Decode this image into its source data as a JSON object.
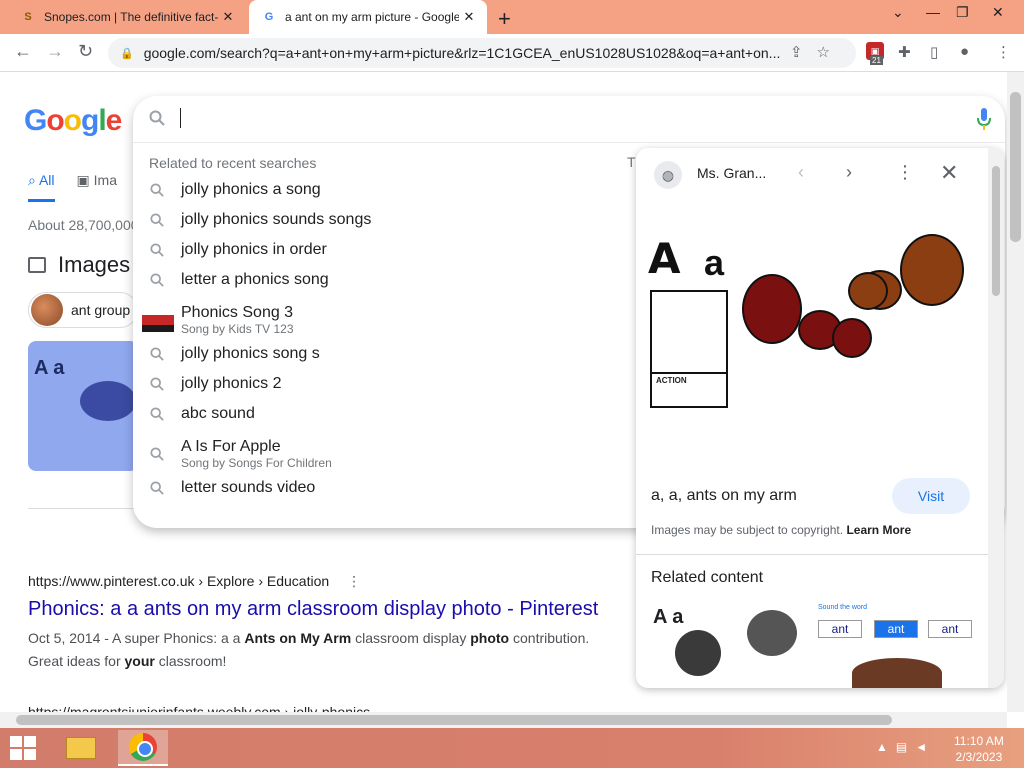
{
  "tabs": [
    {
      "title": "Snopes.com | The definitive fact-",
      "favicon": "snopes-icon",
      "active": false
    },
    {
      "title": "a ant on my arm picture - Google",
      "favicon": "google-icon",
      "active": true
    }
  ],
  "address_bar": {
    "url": "google.com/search?q=a+ant+on+my+arm+picture&rlz=1C1GCEA_enUS1028US1028&oq=a+ant+on...",
    "extension_badge": "21"
  },
  "google": {
    "logo": {
      "G": "G",
      "o1": "o",
      "o2": "o",
      "g": "g",
      "l": "l",
      "e": "e"
    },
    "tabs": {
      "all": "All",
      "images": "Ima"
    },
    "result_stats": "About 28,700,000",
    "images_heading": "Images",
    "chip_label": "ant group",
    "image_card": {
      "A": "A",
      "a": "a"
    }
  },
  "search": {
    "input_value": "",
    "related_label": "Related to recent searches",
    "edge_char": "T",
    "suggestions": [
      {
        "text": "jolly phonics a song",
        "sub": ""
      },
      {
        "text": "jolly phonics sounds songs",
        "sub": ""
      },
      {
        "text": "jolly phonics in order",
        "sub": ""
      },
      {
        "text": "letter a phonics song",
        "sub": ""
      },
      {
        "text": "Phonics Song 3",
        "sub": "Song by Kids TV 123"
      },
      {
        "text": "jolly phonics song s",
        "sub": ""
      },
      {
        "text": "jolly phonics 2",
        "sub": ""
      },
      {
        "text": "abc sound",
        "sub": ""
      },
      {
        "text": "A Is For Apple",
        "sub": "Song by Songs For Children"
      },
      {
        "text": "letter sounds video",
        "sub": ""
      }
    ]
  },
  "result": {
    "cite": "https://www.pinterest.co.uk › Explore › Education",
    "title": "Phonics: a a ants on my arm classroom display photo - Pinterest",
    "snippet": {
      "p1": "Oct 5, 2014 - A super Phonics: a a ",
      "b1": "Ants on My Arm",
      "p2": " classroom display ",
      "b2": "photo",
      "p3": " contribution. Great ideas for ",
      "b3": "your",
      "p4": " classroom!"
    },
    "next_cite": "https://magrontsjuniorinfants.weebly.com › jolly-phonics"
  },
  "preview": {
    "source": "Ms. Gran...",
    "image_text": {
      "big_A": "A",
      "small_a": "a",
      "action": "ACTION"
    },
    "title": "a, a, ants on my arm",
    "visit_label": "Visit",
    "copyright_text": "Images may be subject to copyright.",
    "learn_more": "Learn More",
    "related_heading": "Related content",
    "related_image_text": {
      "A": "A",
      "a": "a",
      "label": "Sound the word",
      "words": [
        "ant",
        "ant",
        "ant"
      ]
    }
  },
  "taskbar": {
    "time": "11:10 AM",
    "date": "2/3/2023"
  },
  "colors": {
    "tab_strip": "#f4a283",
    "link": "#1a0dab",
    "accent": "#1a73e8"
  }
}
